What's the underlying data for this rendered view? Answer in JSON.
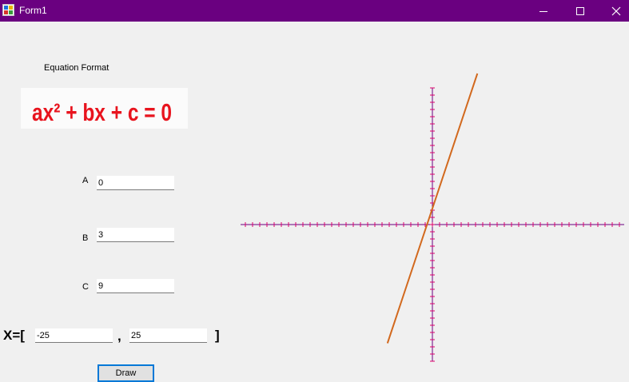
{
  "window": {
    "title": "Form1",
    "icons": {
      "app": "app-icon",
      "minimize": "minimize-icon",
      "maximize": "maximize-icon",
      "close": "close-icon"
    }
  },
  "form": {
    "equation_format_label": "Equation Format",
    "equation_image_text": "ax² + bx + c = 0",
    "a_label": "A",
    "a_value": "0",
    "b_label": "B",
    "b_value": "3",
    "c_label": "C",
    "c_value": "9",
    "x_range_label": "X=[",
    "x_min": "-25",
    "comma": ",",
    "x_max": "25",
    "x_range_close": "]",
    "draw_label": "Draw"
  },
  "colors": {
    "titlebar": "#6a0080",
    "axis": "#6a0080",
    "axis_ticks": "#e0006a",
    "plot_line": "#d2691e",
    "equation_red": "#e8141e"
  },
  "chart_data": {
    "type": "line",
    "title": "",
    "xlabel": "",
    "ylabel": "",
    "grid": false,
    "series": [
      {
        "x": [
          -25,
          25
        ],
        "y": [
          -66,
          84
        ]
      }
    ]
  }
}
